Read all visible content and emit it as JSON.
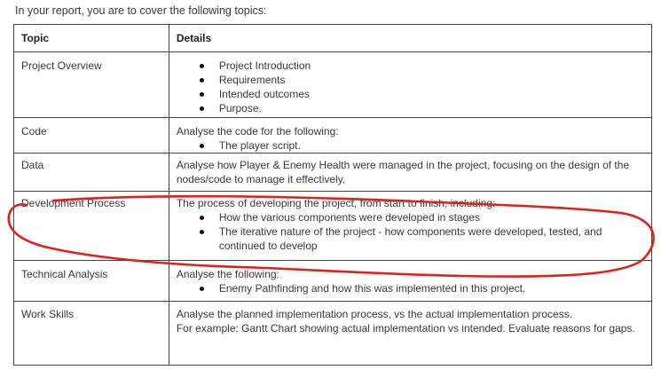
{
  "intro_text": "In your report, you are to cover the following topics:",
  "table": {
    "headers": {
      "topic": "Topic",
      "details": "Details"
    },
    "rows": [
      {
        "topic": "Project Overview",
        "details_lines": [],
        "bullets": [
          "Project Introduction",
          "Requirements",
          "Intended outcomes",
          "Purpose."
        ]
      },
      {
        "topic": "Code",
        "details_lines": [
          "Analyse the code for the following:"
        ],
        "bullets": [
          "The player script."
        ]
      },
      {
        "topic": "Data",
        "details_lines": [
          "Analyse how Player & Enemy Health were managed in the project, focusing on the design of the nodes/code to manage it effectively."
        ],
        "bullets": []
      },
      {
        "topic": "Development Process",
        "details_lines": [
          "The process of developing the project, from start to finish, including:"
        ],
        "bullets": [
          "How the various components were developed in stages",
          "The iterative nature of the project - how components were developed, tested, and continued to develop"
        ]
      },
      {
        "topic": "Technical Analysis",
        "details_lines": [
          "Analyse the following:"
        ],
        "bullets": [
          "Enemy Pathfinding and how this was implemented in this project."
        ]
      },
      {
        "topic": "Work Skills",
        "details_lines": [
          "Analyse the planned implementation process, vs the actual implementation process.",
          "For example: Gantt Chart showing actual implementation vs intended. Evaluate reasons for gaps."
        ],
        "bullets": []
      }
    ]
  },
  "annotation": {
    "color": "#e0201b",
    "target_row": "Development Process"
  }
}
